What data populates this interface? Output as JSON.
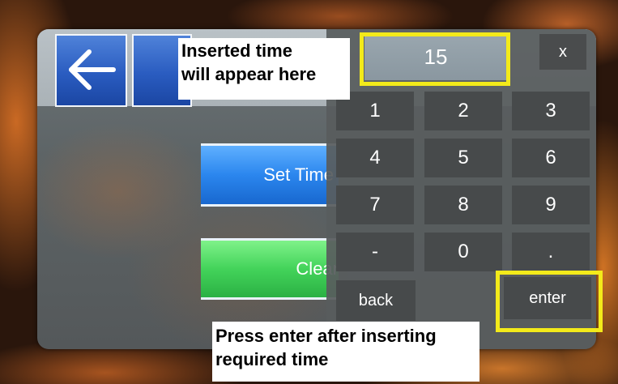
{
  "screen": {
    "set_time_label": "Set Time",
    "clear_label": "Clear"
  },
  "keypad": {
    "display_value": "15",
    "close_label": "x",
    "keys": [
      "1",
      "2",
      "3",
      "4",
      "5",
      "6",
      "7",
      "8",
      "9",
      "-",
      "0",
      "."
    ],
    "back_label": "back",
    "enter_label": "enter"
  },
  "annotations": {
    "top_line1": "Inserted time",
    "top_line2": "will appear here",
    "bottom_line1": "Press enter after inserting",
    "bottom_line2": "required time",
    "highlight_color": "#f3ea1a"
  },
  "icons": {
    "back": "arrow-left-icon"
  }
}
